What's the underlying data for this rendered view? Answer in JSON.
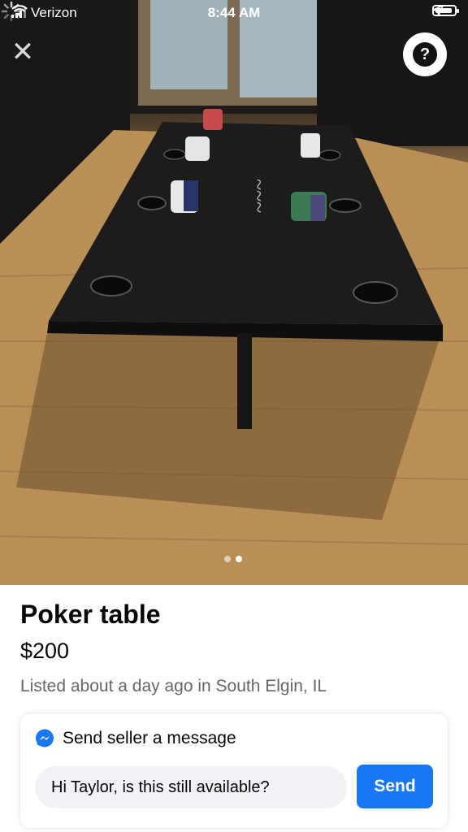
{
  "status_bar": {
    "carrier": "Verizon",
    "time": "8:44 AM"
  },
  "photo": {
    "page_indicator": {
      "current": 2,
      "total": 2
    }
  },
  "listing": {
    "title": "Poker table",
    "price": "$200",
    "meta": "Listed about a day ago in South Elgin, IL"
  },
  "message": {
    "header": "Send seller a message",
    "input_value": "Hi Taylor, is this still available?",
    "send_label": "Send"
  },
  "colors": {
    "accent": "#1877f2",
    "input_bg": "#f0f2f5",
    "meta_text": "#65676b"
  },
  "icons": [
    "signal-icon",
    "wifi-icon",
    "location-arrow-icon",
    "battery-icon",
    "close-icon",
    "help-icon",
    "messenger-icon",
    "loading-spinner-icon"
  ]
}
